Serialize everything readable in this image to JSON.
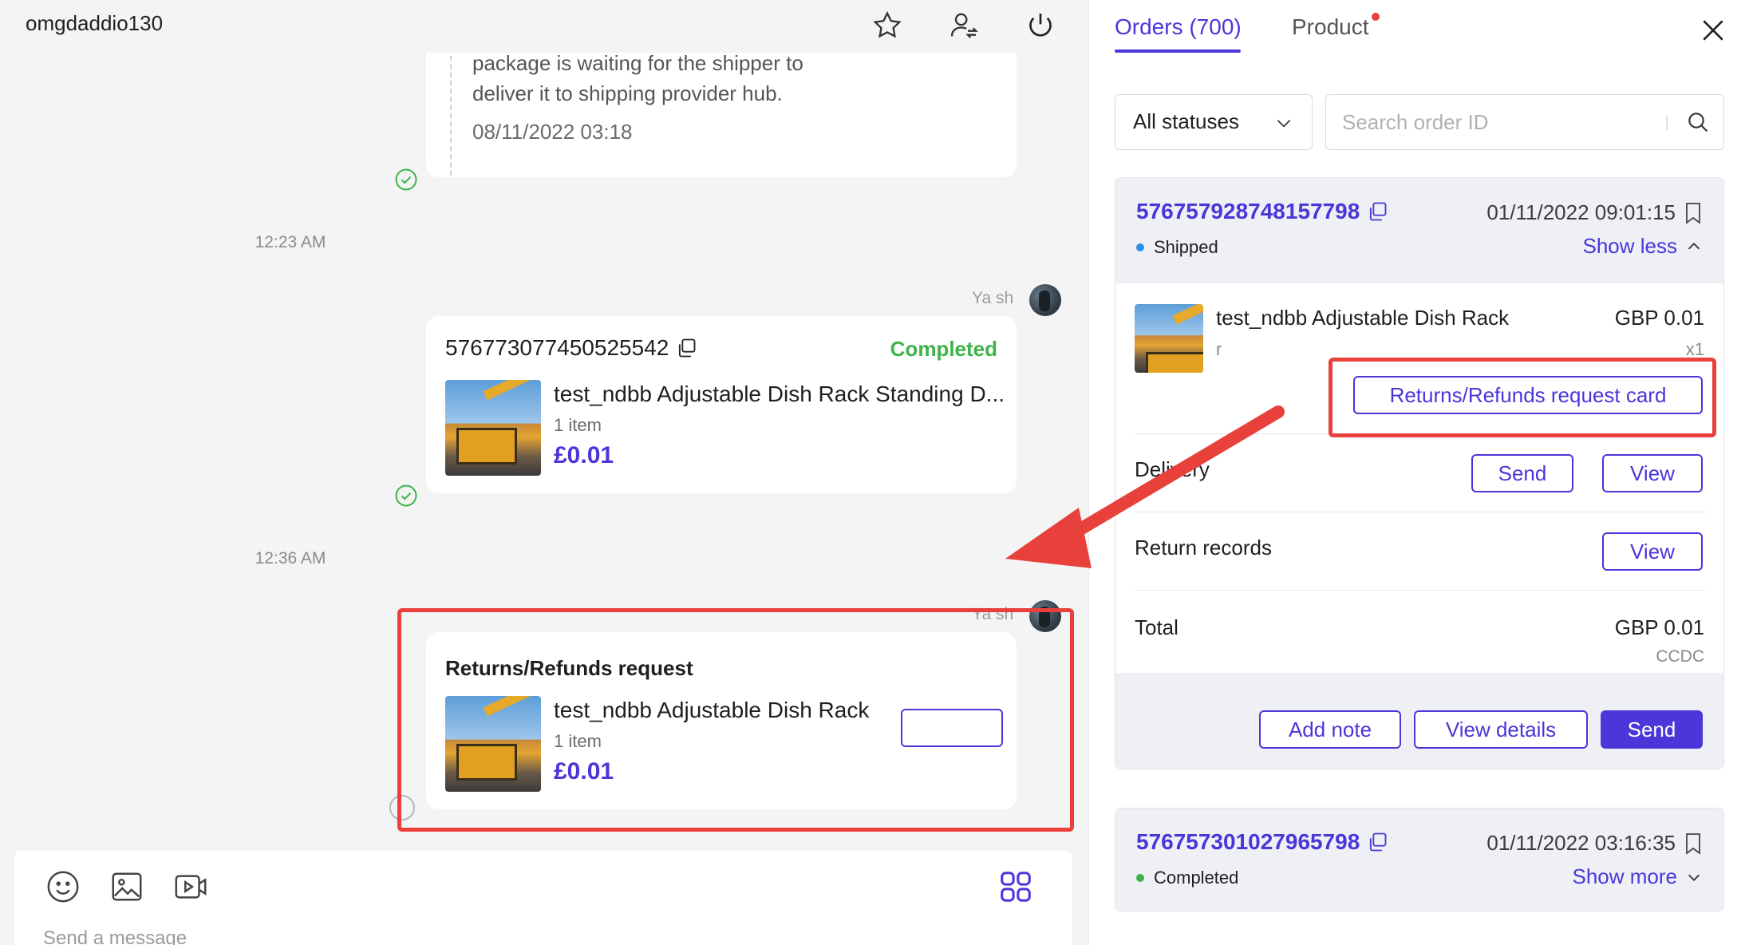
{
  "chat": {
    "username": "omgdaddio130",
    "header_icons": [
      "star-icon",
      "user-transfer-icon",
      "power-icon"
    ],
    "tracking": {
      "line1": "package is waiting for the shipper to",
      "line2": "deliver it to shipping provider hub.",
      "time": "08/11/2022 03:18"
    },
    "time_sep_1": "12:23 AM",
    "time_sep_2": "12:36 AM",
    "sender_1": "Ya sh",
    "sender_2": "Ya sh",
    "order_message": {
      "order_id": "576773077450525542",
      "status": "Completed",
      "product_name": "test_ndbb Adjustable Dish Rack Standing D...",
      "qty": "1 item",
      "price": "£0.01"
    },
    "refund_message": {
      "title": "Returns/Refunds request",
      "product_name": "test_ndbb Adjustable Dish Rack",
      "qty": "1 item",
      "price": "£0.01"
    },
    "composer": {
      "placeholder": "Send a message",
      "icons": [
        "emoji-icon",
        "image-icon",
        "video-icon",
        "apps-grid-icon"
      ]
    }
  },
  "orders": {
    "tabs": [
      {
        "label": "Orders (700)",
        "active": true
      },
      {
        "label": "Product",
        "active": false,
        "has_dot": true
      }
    ],
    "status_filter": "All statuses",
    "search_placeholder": "Search order ID",
    "cards": [
      {
        "order_id": "576757928748157798",
        "date": "01/11/2022 09:01:15",
        "status": "Shipped",
        "status_color": "#2e8ee8",
        "toggle": "Show less",
        "item_name": "test_ndbb Adjustable Dish Rack",
        "item_variant": "r",
        "item_price": "GBP 0.01",
        "item_qty": "x1",
        "refund_card_button": "Returns/Refunds request card",
        "delivery_label": "Delivery",
        "delivery_send": "Send",
        "delivery_view": "View",
        "return_label": "Return records",
        "return_view": "View",
        "total_label": "Total",
        "total_value": "GBP 0.01",
        "total_sub": "CCDC",
        "footer_add_note": "Add note",
        "footer_view_details": "View details",
        "footer_send": "Send"
      },
      {
        "order_id": "576757301027965798",
        "date": "01/11/2022 03:16:35",
        "status": "Completed",
        "status_color": "#3eb34a",
        "toggle": "Show more"
      }
    ]
  },
  "colors": {
    "accent": "#4a36d9",
    "annotation_red": "#e8413c",
    "completed_green": "#3eb34a"
  }
}
